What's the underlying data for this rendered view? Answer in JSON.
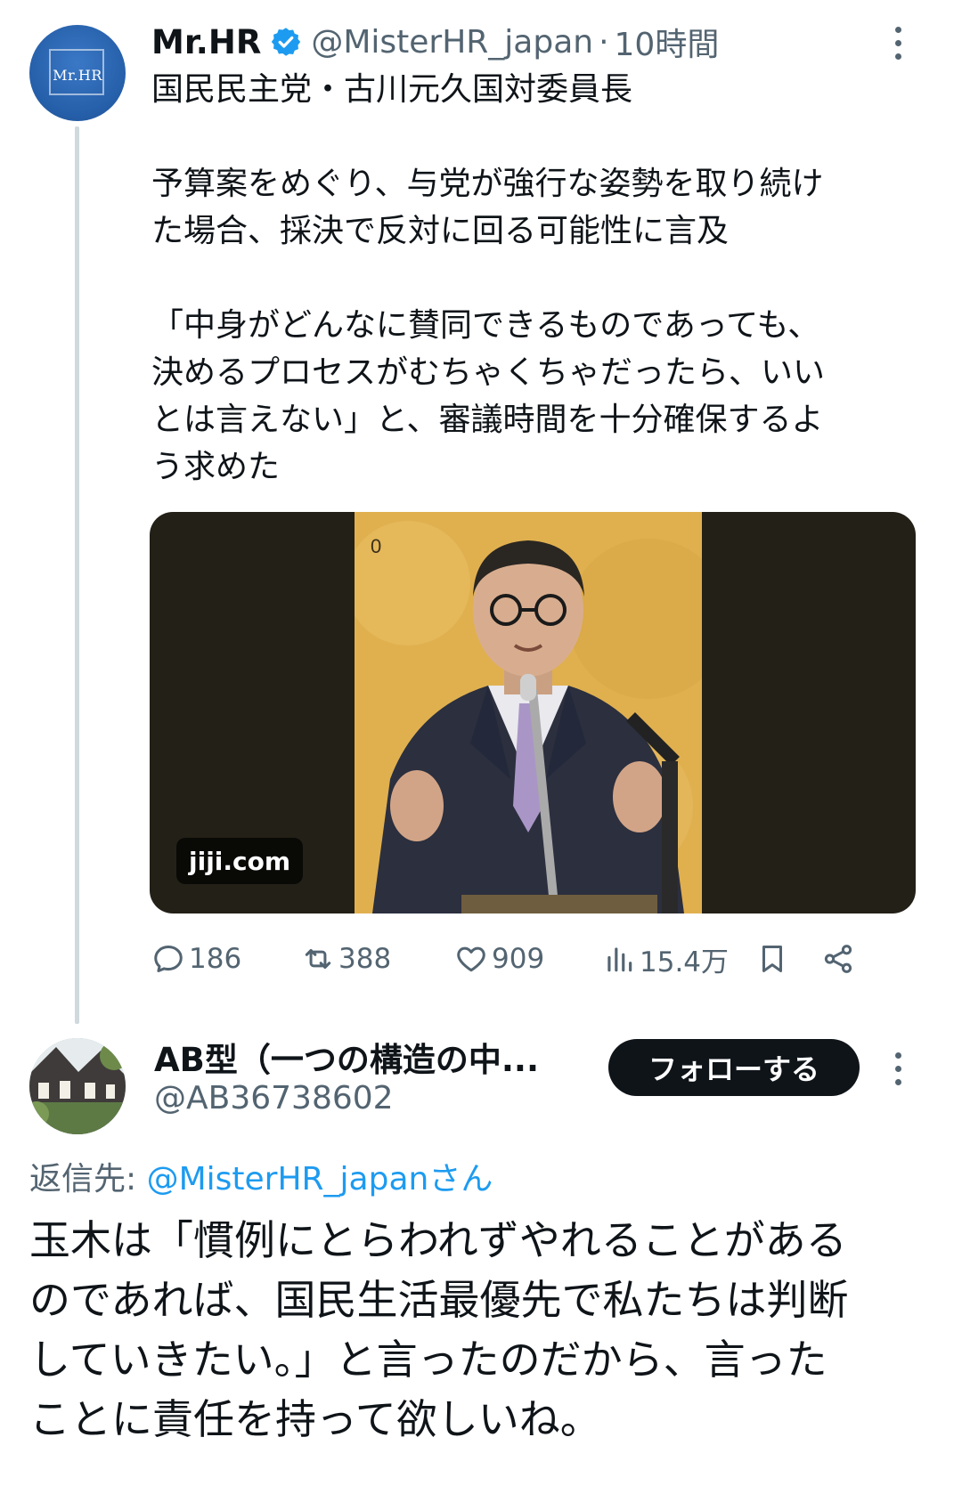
{
  "tweet": {
    "avatar_text": "Mr.HR",
    "author_name": "Mr.HR",
    "handle": "@MisterHR_japan",
    "separator": "·",
    "time": "10時間",
    "paragraphs": [
      "国民民主党・古川元久国対委員長",
      "予算案をめぐり、与党が強行な姿勢を取り続け\nた場合、採決で反対に回る可能性に言及",
      "「中身がどんなに賛同できるものであっても、\n決めるプロセスがむちゃくちゃだったら、いい\nとは言えない」と、審議時間を十分確保するよ\nう求めた"
    ],
    "media": {
      "source_label": "jiji.com",
      "photo_corner_mark": "0"
    },
    "actions": {
      "replies": "186",
      "retweets": "388",
      "likes": "909",
      "views": "15.4万"
    }
  },
  "reply": {
    "author_name": "AB型（一つの構造の中...",
    "handle": "@AB36738602",
    "follow_label": "フォローする",
    "replying_prefix": "返信先: ",
    "replying_to": "@MisterHR_japanさん",
    "text": "玉木は「慣例にとらわれずやれることがある\nのであれば、国民生活最優先で私たちは判断\nしていきたい。」と言ったのだから、言った\nことに責任を持って欲しいね。"
  },
  "colors": {
    "text_primary": "#0f1419",
    "text_secondary": "#536471",
    "link": "#1d9bf0",
    "verified": "#1d9bf0",
    "follow_button": "#0f1419"
  }
}
